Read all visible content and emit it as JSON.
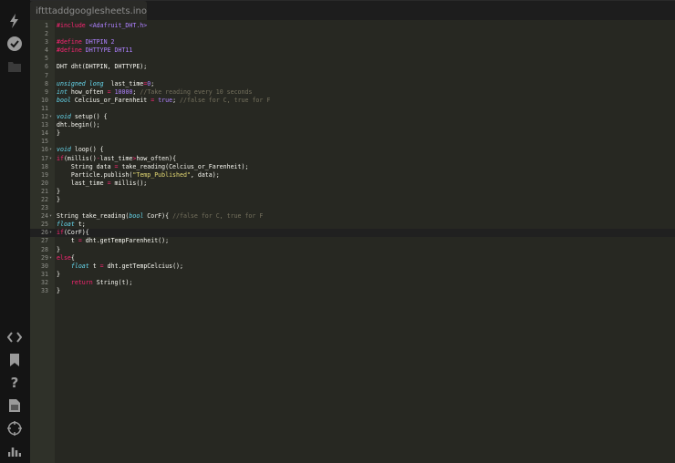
{
  "tab": {
    "filename": "iftttaddgooglesheets.ino"
  },
  "sidebar": {
    "top": [
      "flash-icon",
      "verify-icon",
      "folder-icon"
    ],
    "bottom": [
      "code-icon",
      "bookmark-icon",
      "help-icon",
      "docs-icon",
      "target-icon",
      "chart-icon"
    ]
  },
  "colors": {
    "keyword": "#f92672",
    "type": "#66d9ef",
    "constant": "#ae81ff",
    "string": "#e6db74",
    "comment": "#75715e"
  },
  "active_line": 26,
  "fold_lines": [
    12,
    16,
    17,
    24,
    26,
    29
  ],
  "code": [
    [
      [
        "k",
        "#include "
      ],
      [
        "c",
        "<Adafruit_DHT.h>"
      ]
    ],
    [],
    [
      [
        "k",
        "#define "
      ],
      [
        "c",
        "DHTPIN 2"
      ]
    ],
    [
      [
        "k",
        "#define "
      ],
      [
        "c",
        "DHTTYPE DHT11"
      ]
    ],
    [],
    [
      [
        "",
        "DHT dht(DHTPIN, DHTTYPE);"
      ]
    ],
    [],
    [
      [
        "t",
        "unsigned long"
      ],
      [
        "",
        "  last_time"
      ],
      [
        "k",
        "="
      ],
      [
        "c",
        "0"
      ],
      [
        "",
        ";"
      ]
    ],
    [
      [
        "t",
        "int"
      ],
      [
        "",
        " how_often "
      ],
      [
        "k",
        "="
      ],
      [
        "",
        " "
      ],
      [
        "c",
        "10000"
      ],
      [
        "",
        "; "
      ],
      [
        "m",
        "//Take reading every 10 seconds"
      ]
    ],
    [
      [
        "t",
        "bool"
      ],
      [
        "",
        " Celcius_or_Farenheit "
      ],
      [
        "k",
        "="
      ],
      [
        "",
        " "
      ],
      [
        "c",
        "true"
      ],
      [
        "",
        "; "
      ],
      [
        "m",
        "//false for C, true for F"
      ]
    ],
    [],
    [
      [
        "t",
        "void"
      ],
      [
        "",
        " setup() {"
      ]
    ],
    [
      [
        "",
        "dht.begin();"
      ]
    ],
    [
      [
        "",
        "}"
      ]
    ],
    [],
    [
      [
        "t",
        "void"
      ],
      [
        "",
        " loop() {"
      ]
    ],
    [
      [
        "k",
        "if"
      ],
      [
        "",
        "(millis()"
      ],
      [
        "k",
        "-"
      ],
      [
        "",
        "last_time"
      ],
      [
        "k",
        ">"
      ],
      [
        "",
        "how_often){"
      ]
    ],
    [
      [
        "",
        "    String data "
      ],
      [
        "k",
        "="
      ],
      [
        "",
        " take_reading(Celcius_or_Farenheit);"
      ]
    ],
    [
      [
        "",
        "    Particle.publish("
      ],
      [
        "s",
        "\"Temp_Published\""
      ],
      [
        "",
        ", data);"
      ]
    ],
    [
      [
        "",
        "    last_time "
      ],
      [
        "k",
        "="
      ],
      [
        "",
        " millis();"
      ]
    ],
    [
      [
        "",
        "}"
      ]
    ],
    [
      [
        "",
        "}"
      ]
    ],
    [],
    [
      [
        "",
        "String take_reading("
      ],
      [
        "t",
        "bool"
      ],
      [
        "",
        " CorF){ "
      ],
      [
        "m",
        "//false for C, true for F"
      ]
    ],
    [
      [
        "t",
        "float"
      ],
      [
        "",
        " t;"
      ]
    ],
    [
      [
        "k",
        "if"
      ],
      [
        "",
        "(CorF){"
      ]
    ],
    [
      [
        "",
        "    t "
      ],
      [
        "k",
        "="
      ],
      [
        "",
        " dht.getTempFarenheit();"
      ]
    ],
    [
      [
        "",
        "}"
      ]
    ],
    [
      [
        "k",
        "else"
      ],
      [
        "",
        "{"
      ]
    ],
    [
      [
        "",
        "    "
      ],
      [
        "t",
        "float"
      ],
      [
        "",
        " t "
      ],
      [
        "k",
        "="
      ],
      [
        "",
        " dht.getTempCelcius();"
      ]
    ],
    [
      [
        "",
        "}"
      ]
    ],
    [
      [
        "",
        "    "
      ],
      [
        "k",
        "return"
      ],
      [
        "",
        " String(t);"
      ]
    ],
    [
      [
        "",
        "}"
      ]
    ]
  ]
}
